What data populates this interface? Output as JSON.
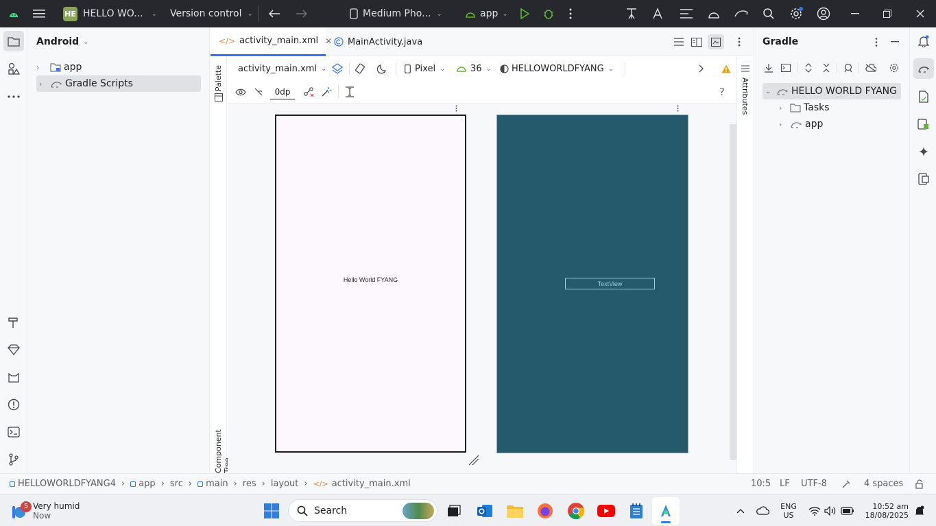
{
  "titlebar": {
    "project_badge": "HE",
    "project_name": "HELLO WO...",
    "version_control": "Version control",
    "device": "Medium Pho...",
    "run_config": "app"
  },
  "project_panel": {
    "view_selector": "Android",
    "items": [
      {
        "label": "app"
      },
      {
        "label": "Gradle Scripts"
      }
    ]
  },
  "editor": {
    "tabs": [
      {
        "label": "activity_main.xml"
      },
      {
        "label": "MainActivity.java"
      }
    ],
    "toolbar": {
      "file": "activity_main.xml",
      "device": "Pixel",
      "api": "36",
      "theme": "HELLOWORLDFYANG",
      "margin": "0dp"
    },
    "side_labels": {
      "palette": "Palette",
      "component_tree": "Component Tree",
      "attributes": "Attributes"
    },
    "design_text": "Hello World FYANG",
    "blueprint_text": "TextView"
  },
  "gradle_panel": {
    "title": "Gradle",
    "root": "HELLO WORLD FYANG",
    "children": [
      {
        "label": "Tasks"
      },
      {
        "label": "app"
      }
    ]
  },
  "statusbar": {
    "breadcrumb": [
      "HELLOWORLDFYANG4",
      "app",
      "src",
      "main",
      "res",
      "layout",
      "activity_main.xml"
    ],
    "position": "10:5",
    "line_sep": "LF",
    "encoding": "UTF-8",
    "indent": "4 spaces"
  },
  "taskbar": {
    "weather_badge": "5",
    "weather_title": "Very humid",
    "weather_sub": "Now",
    "search": "Search",
    "lang1": "ENG",
    "lang2": "US",
    "time": "10:52 am",
    "date": "18/08/2025"
  },
  "colors": {
    "accent": "#3574f0",
    "android_green": "#3ddc84",
    "blueprint_bg": "#245a6b",
    "design_bg": "#fdf7fe"
  }
}
